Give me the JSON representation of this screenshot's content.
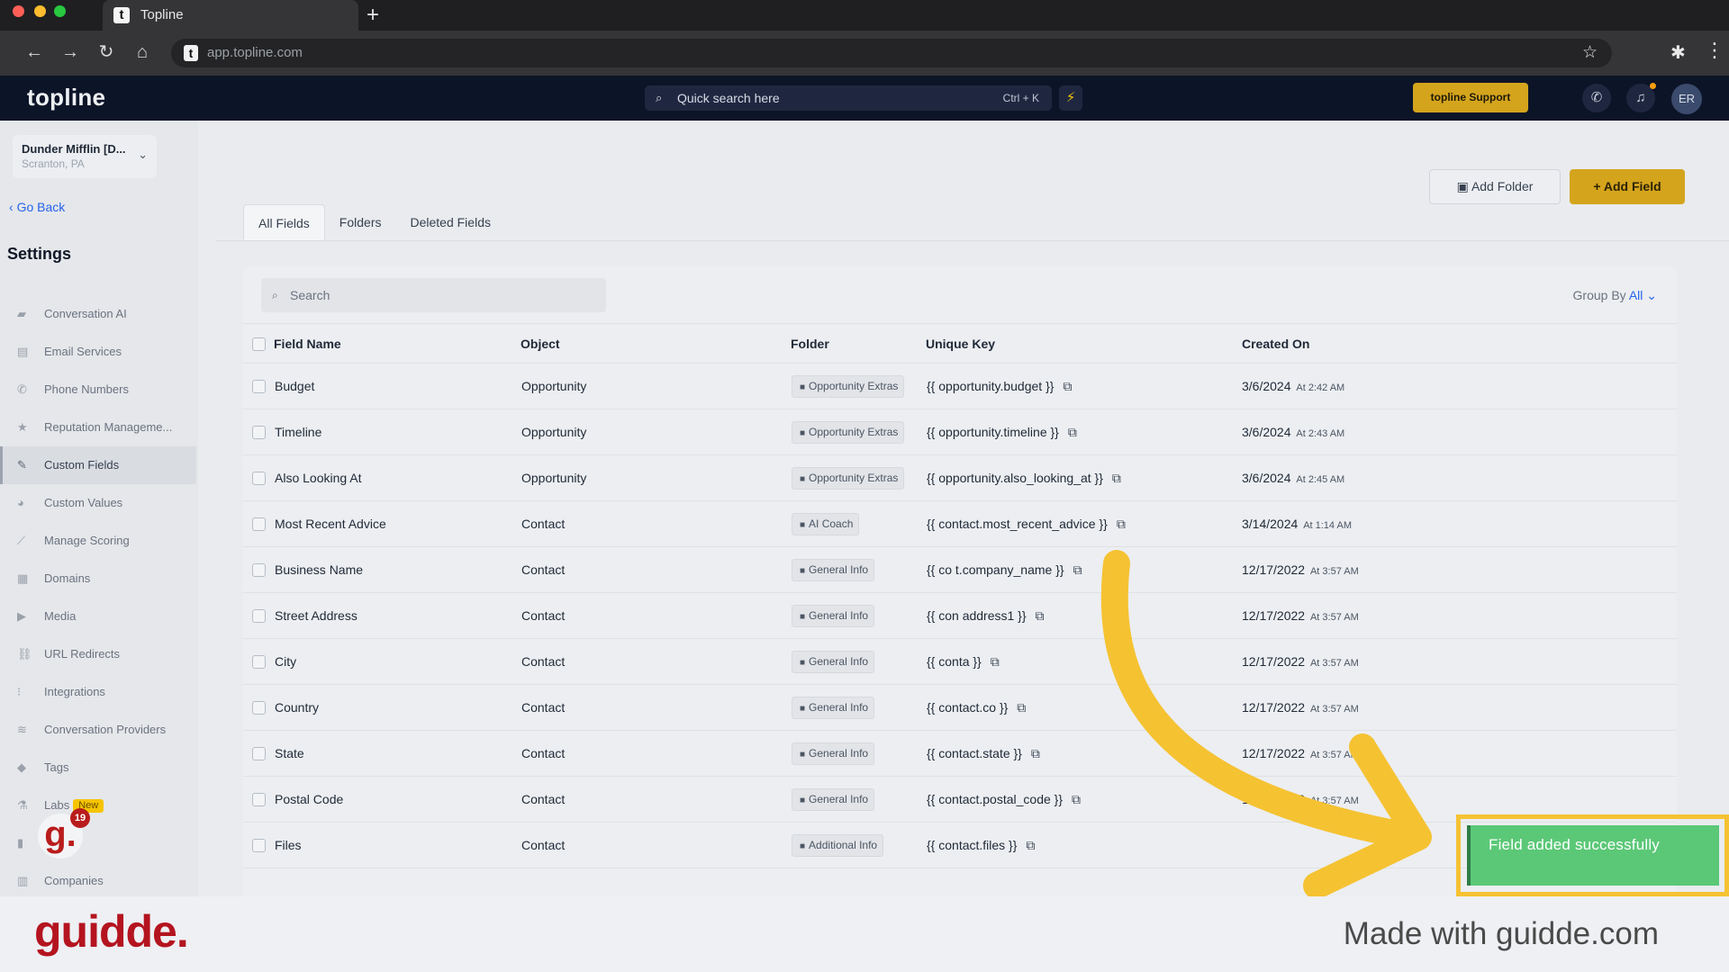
{
  "browser": {
    "tab_title": "Topline",
    "tab_logo": "t",
    "url": "app.topline.com",
    "colors": {
      "close": "#ff5f57",
      "minimize": "#febc2e",
      "maximize": "#28c840"
    }
  },
  "header": {
    "brand": "topline",
    "search_placeholder": "Quick search here",
    "search_shortcut": "Ctrl + K",
    "support_label": "topline Support",
    "avatar_initials": "ER"
  },
  "sidebar": {
    "account_name": "Dunder Mifflin [D...",
    "account_location": "Scranton, PA",
    "go_back": "Go Back",
    "title": "Settings",
    "items": [
      {
        "label": "Conversation AI",
        "icon": "chat-icon"
      },
      {
        "label": "Email Services",
        "icon": "email-icon"
      },
      {
        "label": "Phone Numbers",
        "icon": "phone-icon"
      },
      {
        "label": "Reputation Manageme...",
        "icon": "star-icon"
      },
      {
        "label": "Custom Fields",
        "icon": "edit-icon",
        "active": true
      },
      {
        "label": "Custom Values",
        "icon": "pie-icon"
      },
      {
        "label": "Manage Scoring",
        "icon": "chart-line-icon"
      },
      {
        "label": "Domains",
        "icon": "domain-icon"
      },
      {
        "label": "Media",
        "icon": "media-icon"
      },
      {
        "label": "URL Redirects",
        "icon": "link-icon"
      },
      {
        "label": "Integrations",
        "icon": "integrations-icon"
      },
      {
        "label": "Conversation Providers",
        "icon": "provider-icon"
      },
      {
        "label": "Tags",
        "icon": "tag-icon"
      },
      {
        "label": "Labs",
        "icon": "flask-icon",
        "badge": "New"
      },
      {
        "label": "ogs",
        "icon": "bar-chart-icon"
      },
      {
        "label": "Companies",
        "icon": "companies-icon"
      }
    ],
    "guidde_badge_letter": "g.",
    "guidde_badge_count": "19"
  },
  "main": {
    "add_folder": "Add Folder",
    "add_field": "+ Add Field",
    "tabs": [
      "All Fields",
      "Folders",
      "Deleted Fields"
    ],
    "search_placeholder": "Search",
    "group_by_label": "Group By",
    "group_by_value": "All",
    "columns": [
      "Field Name",
      "Object",
      "Folder",
      "Unique Key",
      "Created On"
    ],
    "rows": [
      {
        "name": "Budget",
        "object": "Opportunity",
        "folder": "Opportunity Extras",
        "key": "{{ opportunity.budget }}",
        "date": "3/6/2024",
        "time": "At 2:42 AM"
      },
      {
        "name": "Timeline",
        "object": "Opportunity",
        "folder": "Opportunity Extras",
        "key": "{{ opportunity.timeline }}",
        "date": "3/6/2024",
        "time": "At 2:43 AM"
      },
      {
        "name": "Also Looking At",
        "object": "Opportunity",
        "folder": "Opportunity Extras",
        "key": "{{ opportunity.also_looking_at }}",
        "date": "3/6/2024",
        "time": "At 2:45 AM"
      },
      {
        "name": "Most Recent Advice",
        "object": "Contact",
        "folder": "AI Coach",
        "key": "{{ contact.most_recent_advice }}",
        "date": "3/14/2024",
        "time": "At 1:14 AM"
      },
      {
        "name": "Business Name",
        "object": "Contact",
        "folder": "General Info",
        "key": "{{ co    t.company_name }}",
        "date": "12/17/2022",
        "time": "At 3:57 AM"
      },
      {
        "name": "Street Address",
        "object": "Contact",
        "folder": "General Info",
        "key": "{{ con     address1 }}",
        "date": "12/17/2022",
        "time": "At 3:57 AM"
      },
      {
        "name": "City",
        "object": "Contact",
        "folder": "General Info",
        "key": "{{ conta      }}",
        "date": "12/17/2022",
        "time": "At 3:57 AM"
      },
      {
        "name": "Country",
        "object": "Contact",
        "folder": "General Info",
        "key": "{{ contact.co      }}",
        "date": "12/17/2022",
        "time": "At 3:57 AM"
      },
      {
        "name": "State",
        "object": "Contact",
        "folder": "General Info",
        "key": "{{ contact.state }}",
        "date": "12/17/2022",
        "time": "At 3:57 AM"
      },
      {
        "name": "Postal Code",
        "object": "Contact",
        "folder": "General Info",
        "key": "{{ contact.postal_code }}",
        "date": "12/17/2022",
        "time": "At 3:57 AM"
      },
      {
        "name": "Files",
        "object": "Contact",
        "folder": "Additional Info",
        "key": "{{ contact.files }}",
        "date": "",
        "time": ""
      }
    ]
  },
  "toast": {
    "message": "Field added successfully"
  },
  "footer": {
    "logo": "guidde.",
    "tagline": "Made with guidde.com"
  },
  "colors": {
    "accent": "#d4a41d",
    "toast": "#5bc877",
    "highlight": "#f5c232",
    "brand_red": "#b4141f",
    "header_bg": "#0c1427"
  }
}
